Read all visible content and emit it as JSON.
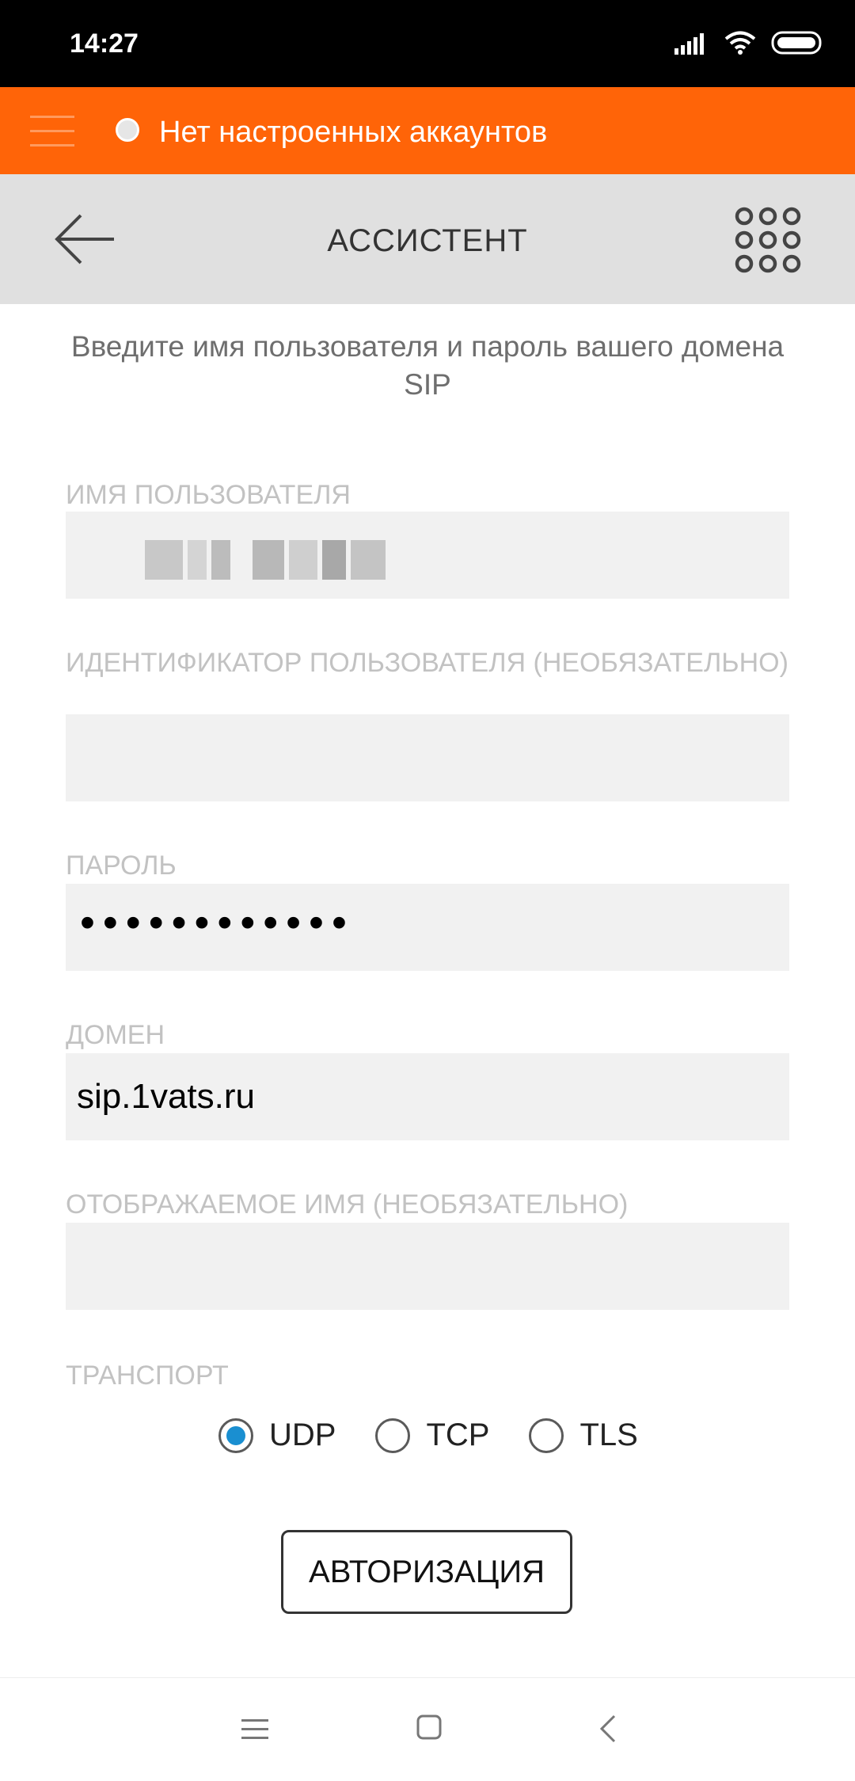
{
  "status_bar": {
    "time": "14:27"
  },
  "top_bar": {
    "account_status": "Нет настроенных аккаунтов"
  },
  "assistant": {
    "title": "АССИСТЕНТ"
  },
  "form": {
    "intro": "Введите имя пользователя и пароль вашего домена SIP",
    "username_label": "ИМЯ ПОЛЬЗОВАТЕЛЯ",
    "userid_label": "ИДЕНТИФИКАТОР ПОЛЬЗОВАТЕЛЯ (НЕОБЯЗАТЕЛЬНО)",
    "userid_value": "",
    "password_label": "ПАРОЛЬ",
    "password_value": "••••••••••••",
    "domain_label": "ДОМЕН",
    "domain_value": "sip.1vats.ru",
    "display_name_label": "ОТОБРАЖАЕМОЕ ИМЯ (НЕОБЯЗАТЕЛЬНО)",
    "display_name_value": "",
    "transport_label": "ТРАНСПОРТ",
    "transport_options": [
      "UDP",
      "TCP",
      "TLS"
    ],
    "transport_selected": "UDP",
    "auth_button": "АВТОРИЗАЦИЯ"
  },
  "colors": {
    "accent": "#ff6408",
    "radio_selected": "#1a8fd1",
    "header_bg": "#e0e0e0"
  }
}
